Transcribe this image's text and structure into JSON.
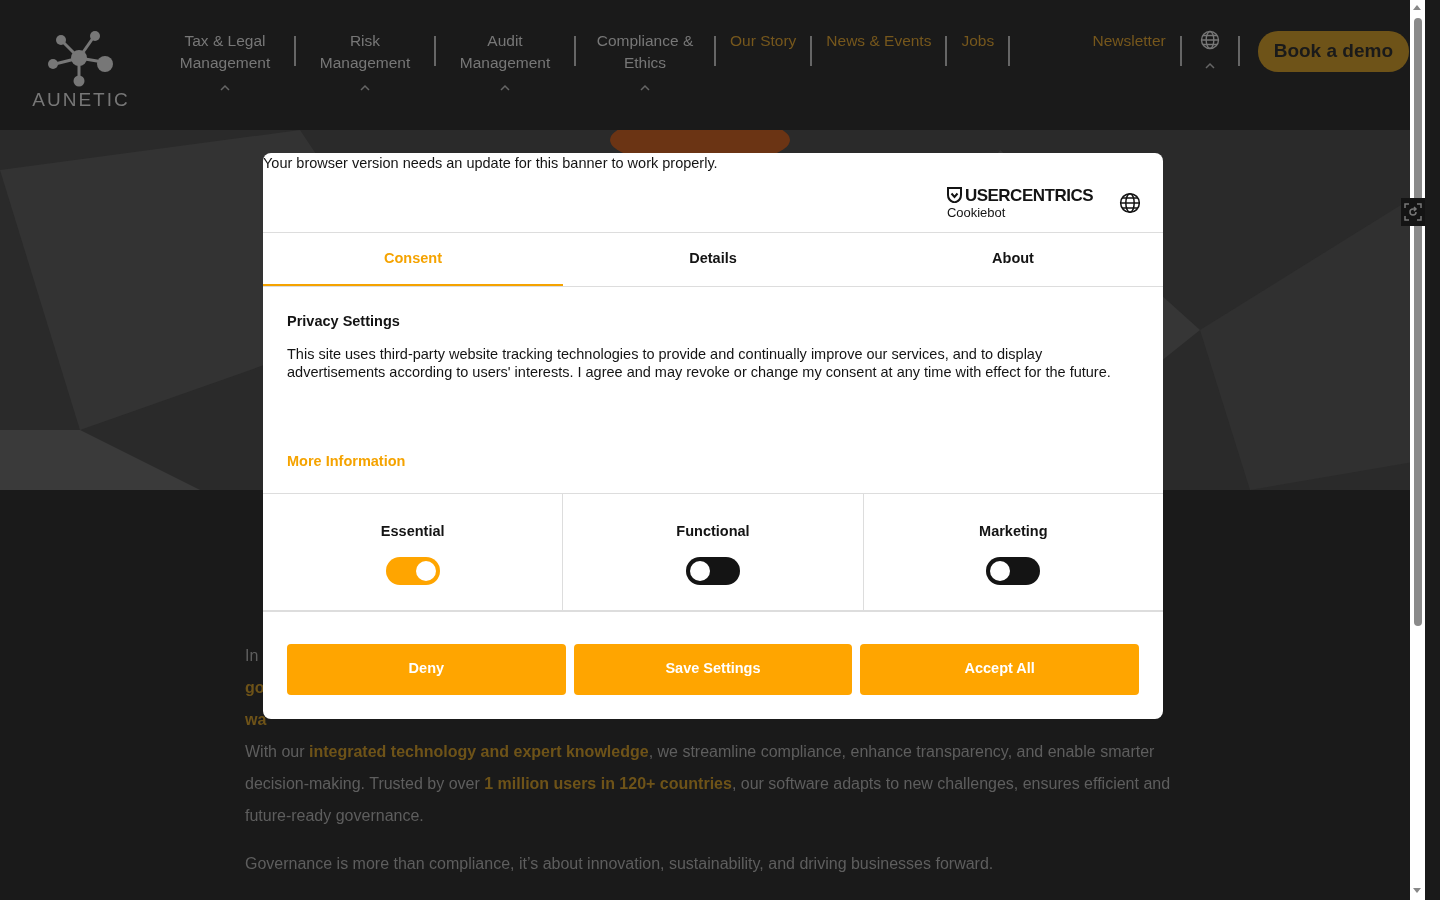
{
  "header": {
    "logo": {
      "name": "AUNETIC"
    },
    "nav_items": [
      {
        "label": "Tax & Legal Management",
        "kind": "dropdown"
      },
      {
        "label": "Risk Management",
        "kind": "dropdown"
      },
      {
        "label": "Audit Management",
        "kind": "dropdown"
      },
      {
        "label": "Compliance & Ethics",
        "kind": "dropdown"
      },
      {
        "label": "Our Story",
        "kind": "link"
      },
      {
        "label": "News & Events",
        "kind": "link"
      },
      {
        "label": "Jobs",
        "kind": "link"
      }
    ],
    "newsletter": "Newsletter",
    "cta_button": "Book a demo"
  },
  "page": {
    "fragments": [
      "In",
      "go",
      "wa"
    ],
    "paragraphs": [
      "With our **integrated technology and expert knowledge**, we streamline compliance, enhance transparency, and enable smarter decision-making. Trusted by over **1 million users in 120+ countries**, our software adapts to new challenges, ensures efficient and future-ready governance.",
      "Governance is more than compliance, it’s about innovation, sustainability, and driving businesses forward."
    ]
  },
  "consent_dialog": {
    "notice": "Your browser version needs an update for this banner to work properly.",
    "brand": {
      "name": "USERCENTRICS",
      "product": "Cookiebot"
    },
    "tabs": [
      {
        "label": "Consent",
        "selected": true
      },
      {
        "label": "Details",
        "selected": false
      },
      {
        "label": "About",
        "selected": false
      }
    ],
    "title": "Privacy Settings",
    "text": "This site uses third-party website tracking technologies to provide and continually improve our services, and to display advertisements according to users' interests. I agree and may revoke or change my consent at any time with effect for the future.",
    "more_link": "More Information",
    "toggles": [
      {
        "label": "Essential",
        "on": true
      },
      {
        "label": "Functional",
        "on": false
      },
      {
        "label": "Marketing",
        "on": false
      }
    ],
    "buttons": [
      "Deny",
      "Save Settings",
      "Accept All"
    ]
  }
}
